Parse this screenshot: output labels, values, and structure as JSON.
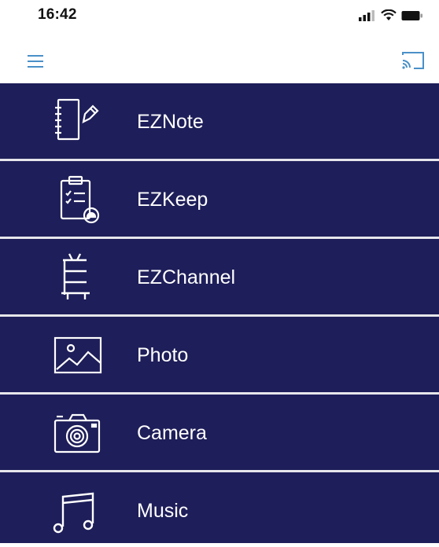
{
  "status_bar": {
    "time": "16:42",
    "icons": [
      "signal-icon",
      "wifi-icon",
      "battery-icon"
    ]
  },
  "toolbar": {
    "menu_icon": "hamburger-menu-icon",
    "cast_icon": "cast-icon",
    "accent_color": "#4a90c8"
  },
  "menu": {
    "background_color": "#1e1e5a",
    "items": [
      {
        "label": "EZNote",
        "icon": "notebook-pencil-icon"
      },
      {
        "label": "EZKeep",
        "icon": "clipboard-checklist-icon"
      },
      {
        "label": "EZChannel",
        "icon": "tv-channel-icon"
      },
      {
        "label": "Photo",
        "icon": "image-icon"
      },
      {
        "label": "Camera",
        "icon": "camera-icon"
      },
      {
        "label": "Music",
        "icon": "music-note-icon"
      }
    ]
  }
}
